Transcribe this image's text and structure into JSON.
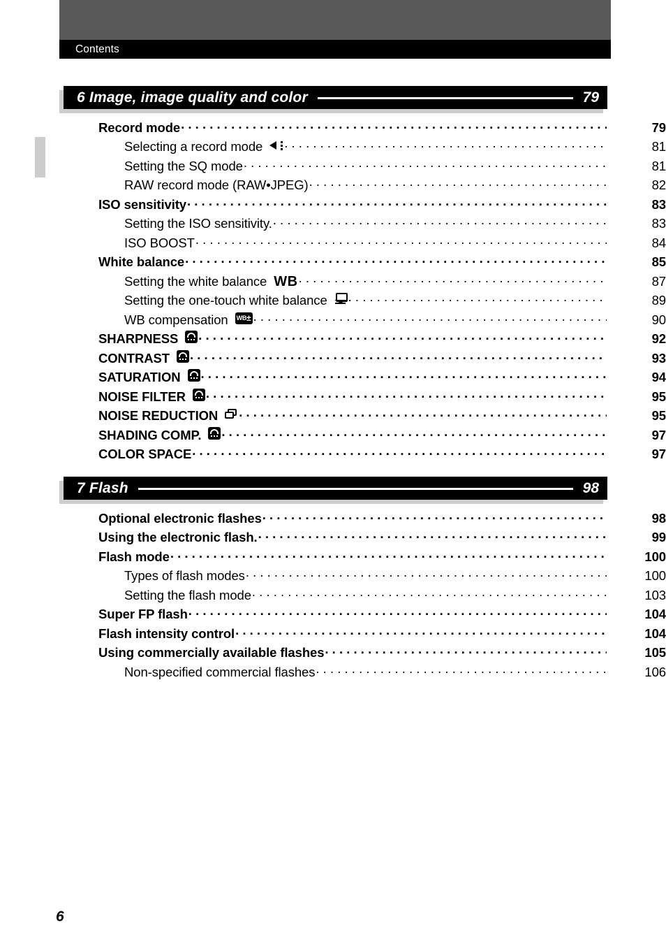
{
  "running_head": {
    "label": "Contents"
  },
  "folio": "6",
  "sections": [
    {
      "number": "6",
      "title": "6 Image, image quality and color",
      "page": "79",
      "entries": [
        {
          "level": 1,
          "label": "Record mode",
          "icon": null,
          "page": "79"
        },
        {
          "level": 2,
          "label": "Selecting a record mode",
          "icon": "record-mode-icon",
          "page": "81"
        },
        {
          "level": 2,
          "label": "Setting the SQ mode",
          "icon": null,
          "page": "81"
        },
        {
          "level": 2,
          "label": "RAW record mode (RAW•JPEG)",
          "icon": null,
          "page": "82"
        },
        {
          "level": 1,
          "label": "ISO sensitivity",
          "icon": null,
          "page": "83"
        },
        {
          "level": 2,
          "label": "Setting the ISO sensitivity.",
          "icon": null,
          "page": "83"
        },
        {
          "level": 2,
          "label": "ISO BOOST",
          "icon": null,
          "page": "84"
        },
        {
          "level": 1,
          "label": "White balance",
          "icon": null,
          "page": "85"
        },
        {
          "level": 2,
          "label": "Setting the white balance",
          "icon": "wb-text-icon",
          "page": "87"
        },
        {
          "level": 2,
          "label": "Setting the one-touch white balance",
          "icon": "one-touch-wb-icon",
          "page": "89"
        },
        {
          "level": 2,
          "label": "WB compensation",
          "icon": "wb-compensation-icon",
          "page": "90"
        },
        {
          "level": 1,
          "label": "SHARPNESS",
          "icon": "picture-mode-icon",
          "page": "92"
        },
        {
          "level": 1,
          "label": "CONTRAST",
          "icon": "picture-mode-icon",
          "page": "93"
        },
        {
          "level": 1,
          "label": "SATURATION",
          "icon": "picture-mode-icon",
          "page": "94"
        },
        {
          "level": 1,
          "label": "NOISE FILTER",
          "icon": "picture-mode-icon",
          "page": "95"
        },
        {
          "level": 1,
          "label": "NOISE REDUCTION",
          "icon": "noise-reduction-icon",
          "page": "95"
        },
        {
          "level": 1,
          "label": "SHADING COMP.",
          "icon": "picture-mode-icon",
          "page": "97"
        },
        {
          "level": 1,
          "label": "COLOR SPACE",
          "icon": null,
          "page": "97"
        }
      ]
    },
    {
      "number": "7",
      "title": "7 Flash",
      "page": "98",
      "entries": [
        {
          "level": 1,
          "label": "Optional electronic flashes",
          "icon": null,
          "page": "98"
        },
        {
          "level": 1,
          "label": "Using the electronic flash.",
          "icon": null,
          "page": "99"
        },
        {
          "level": 1,
          "label": "Flash mode",
          "icon": null,
          "page": "100"
        },
        {
          "level": 2,
          "label": "Types of flash modes",
          "icon": null,
          "page": "100"
        },
        {
          "level": 2,
          "label": "Setting the flash mode",
          "icon": null,
          "page": "103"
        },
        {
          "level": 1,
          "label": "Super FP flash",
          "icon": null,
          "page": "104"
        },
        {
          "level": 1,
          "label": "Flash intensity control",
          "icon": null,
          "page": "104"
        },
        {
          "level": 1,
          "label": "Using commercially available flashes",
          "icon": null,
          "page": "105"
        },
        {
          "level": 2,
          "label": "Non-specified commercial flashes",
          "icon": null,
          "page": "106"
        }
      ]
    }
  ],
  "icon_labels": {
    "record-mode-icon": "record-mode",
    "wb-text-icon": "WB",
    "one-touch-wb-icon": "one-touch-white-balance",
    "wb-compensation-icon": "WB-compensation",
    "picture-mode-icon": "picture-mode",
    "noise-reduction-icon": "noise-reduction"
  },
  "colors": {
    "band_gray": "#595959",
    "bar_black": "#000000",
    "shadow_gray": "#cdcdcd",
    "tab_gray": "#cdcdcd"
  }
}
